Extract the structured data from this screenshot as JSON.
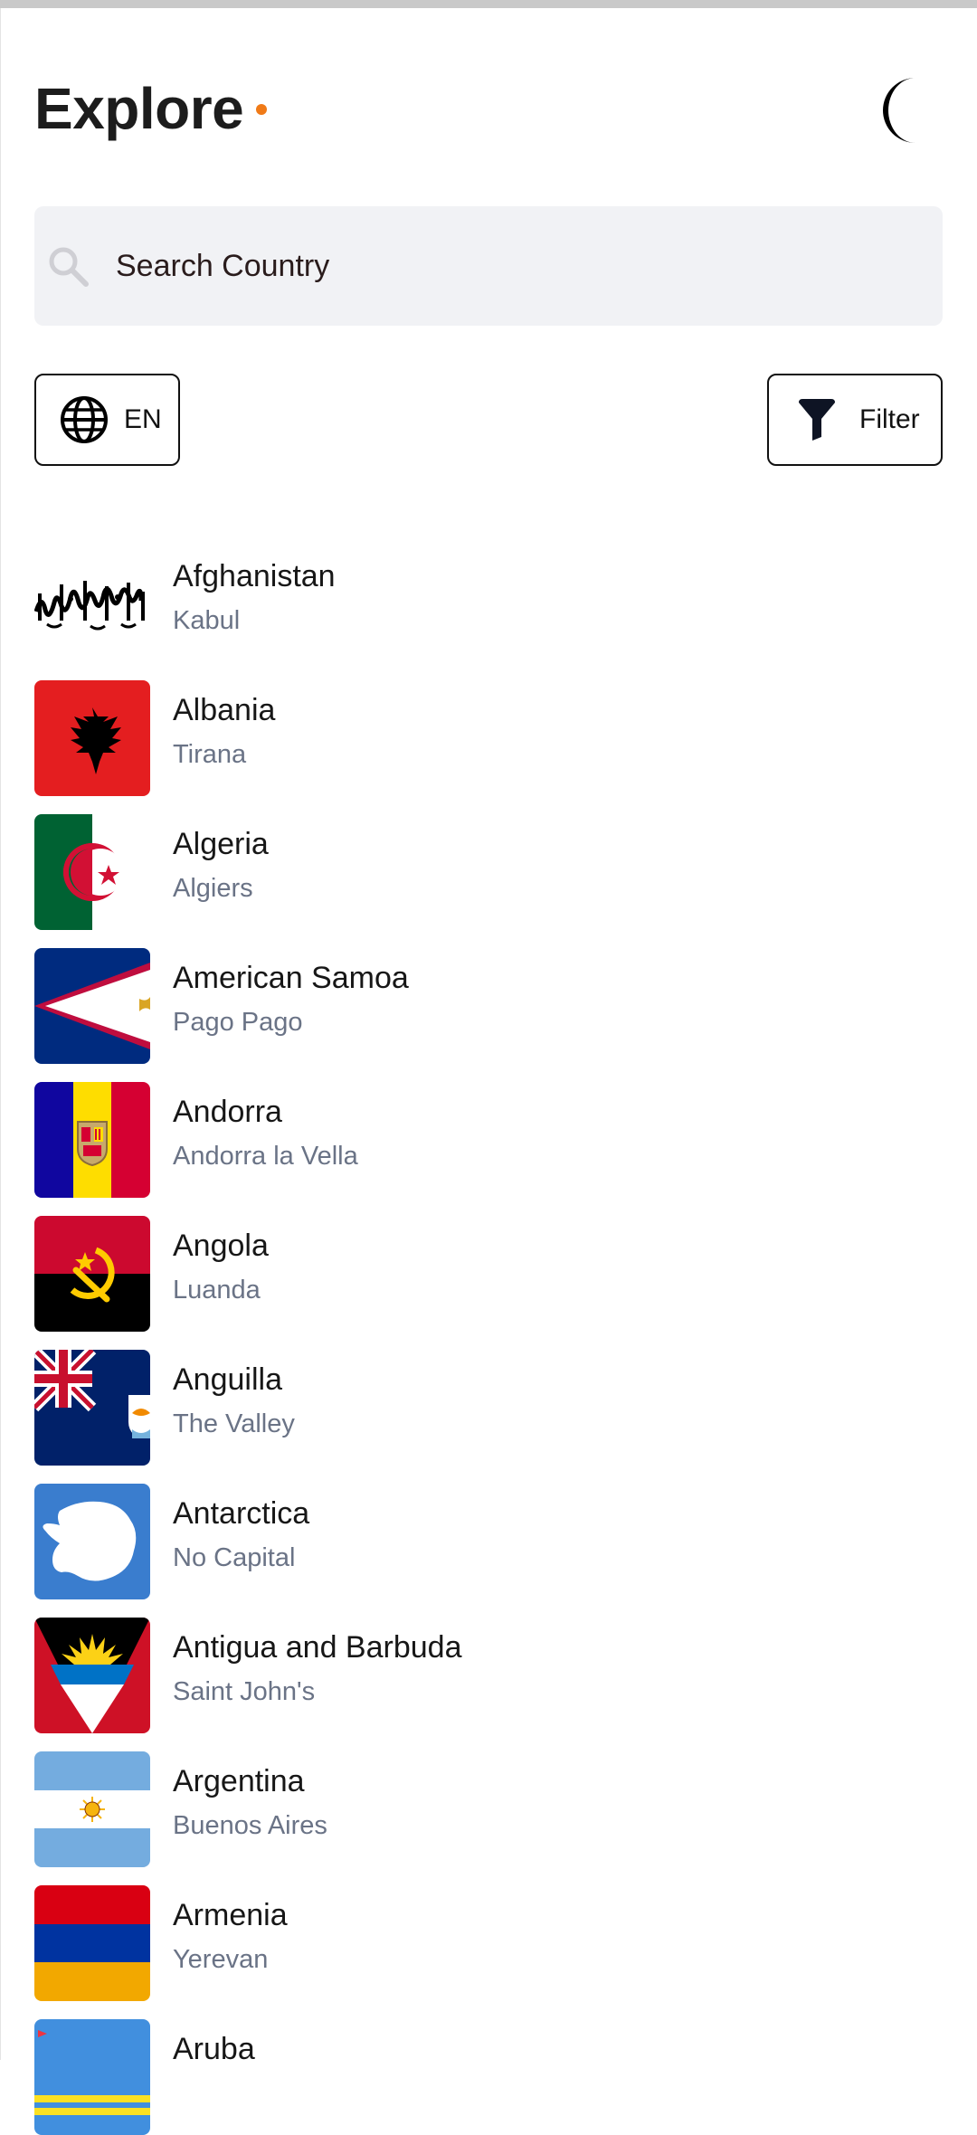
{
  "header": {
    "title": "Explore",
    "accent_color": "#f07a17",
    "theme_toggle_icon": "moon-icon"
  },
  "search": {
    "placeholder": "Search Country",
    "icon": "search-icon"
  },
  "language": {
    "label": "EN",
    "icon": "globe-icon"
  },
  "filter": {
    "label": "Filter",
    "icon": "funnel-icon"
  },
  "countries": [
    {
      "name": "Afghanistan",
      "capital": "Kabul"
    },
    {
      "name": "Albania",
      "capital": "Tirana"
    },
    {
      "name": "Algeria",
      "capital": "Algiers"
    },
    {
      "name": "American Samoa",
      "capital": "Pago Pago"
    },
    {
      "name": "Andorra",
      "capital": "Andorra la Vella"
    },
    {
      "name": "Angola",
      "capital": "Luanda"
    },
    {
      "name": "Anguilla",
      "capital": "The Valley"
    },
    {
      "name": "Antarctica",
      "capital": "No Capital"
    },
    {
      "name": "Antigua and Barbuda",
      "capital": "Saint John's"
    },
    {
      "name": "Argentina",
      "capital": "Buenos Aires"
    },
    {
      "name": "Armenia",
      "capital": "Yerevan"
    },
    {
      "name": "Aruba",
      "capital": ""
    }
  ],
  "colors": {
    "capital_text": "#6a7386",
    "search_bg": "#f1f2f5"
  }
}
